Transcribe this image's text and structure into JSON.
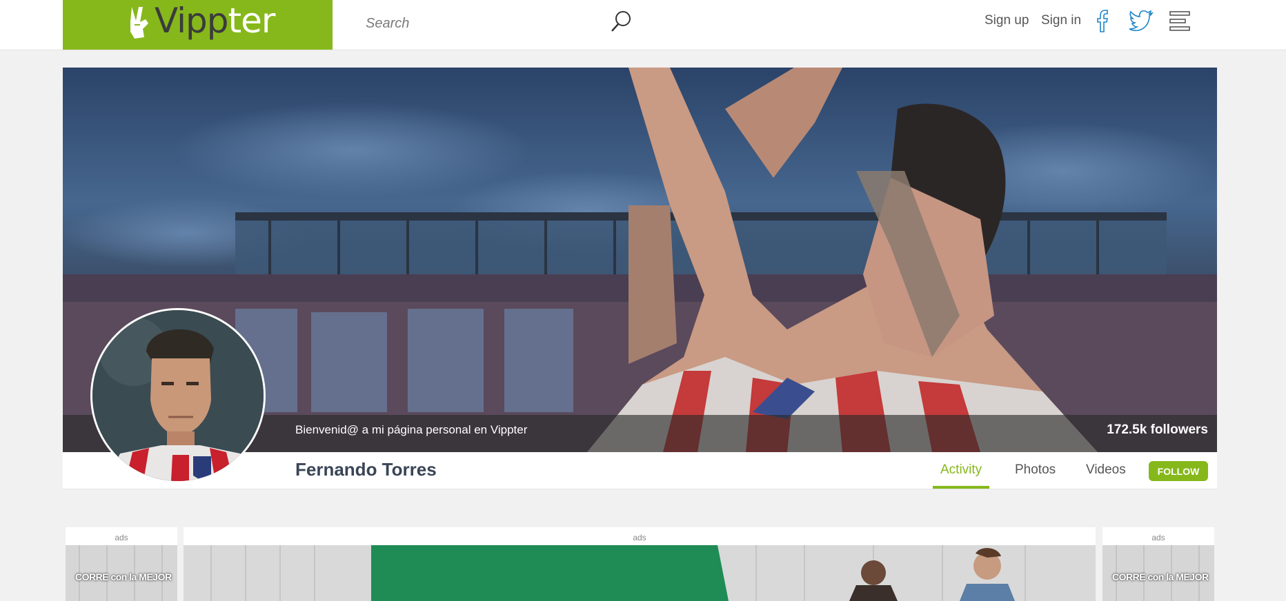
{
  "brand": {
    "name_part1": "Vipp",
    "name_part2": "ter",
    "accent_color": "#86b81b",
    "logo_icon": "peace-hand-icon"
  },
  "header": {
    "search_placeholder": "Search",
    "search_icon": "search-icon",
    "sign_up": "Sign up",
    "sign_in": "Sign in",
    "social_icons": [
      "facebook-icon",
      "twitter-icon",
      "menu-icon"
    ]
  },
  "cover": {
    "tagline": "Bienvenid@ a mi página personal en Vippter",
    "followers": "172.5k followers"
  },
  "profile": {
    "name": "Fernando Torres",
    "tabs": [
      {
        "label": "Activity",
        "active": true
      },
      {
        "label": "Photos",
        "active": false
      },
      {
        "label": "Videos",
        "active": false
      }
    ],
    "follow_label": "FOLLOW"
  },
  "ads": {
    "left_label": "ads",
    "main_label": "ads",
    "right_label": "ads",
    "left_text": "CORRE con la MEJOR",
    "right_text": "CORRE con la MEJOR"
  }
}
